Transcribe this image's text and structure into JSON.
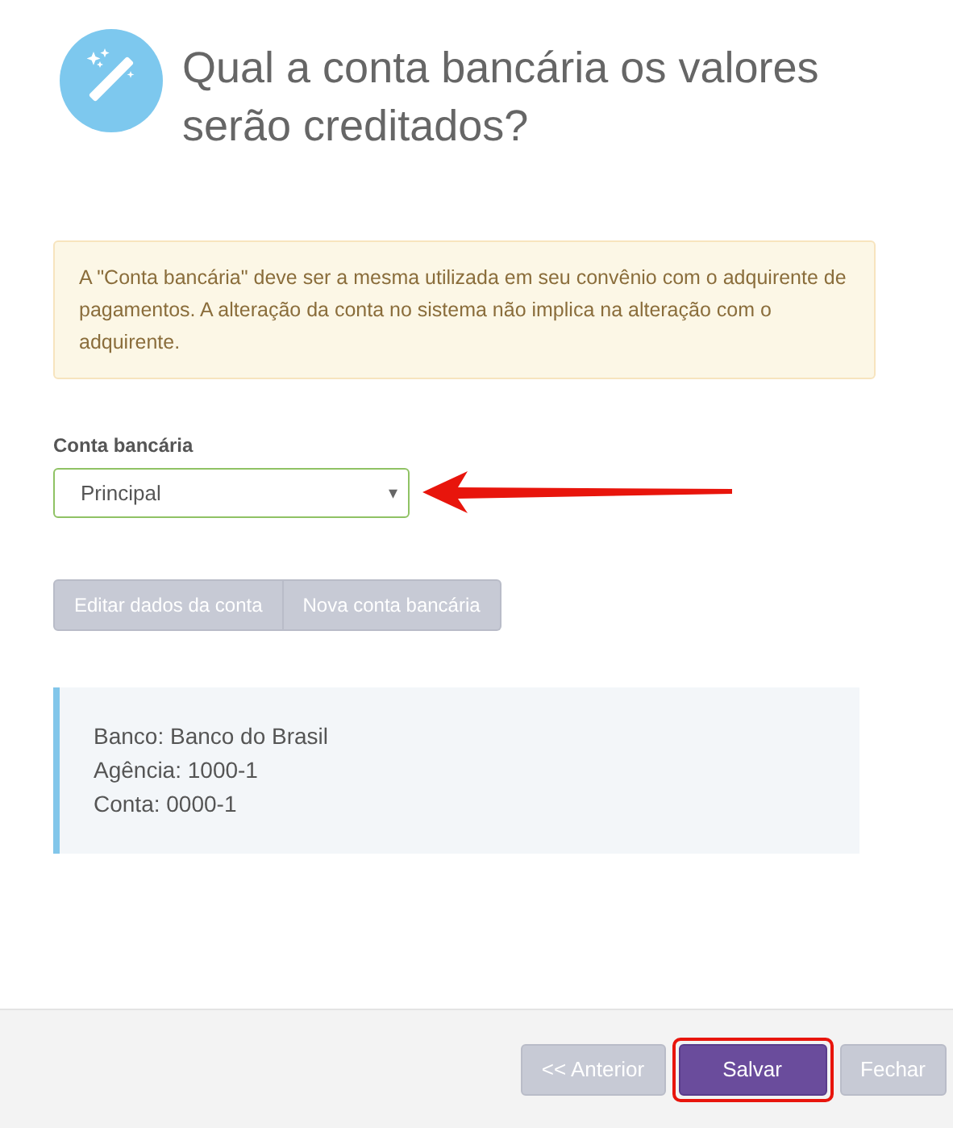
{
  "title": "Qual a conta bancária os valores serão creditados?",
  "alert": "A \"Conta bancária\" deve ser a mesma utilizada em seu convênio com o adquirente de pagamentos. A alteração da conta no sistema não implica na alteração com o adquirente.",
  "field": {
    "label": "Conta bancária",
    "value": "Principal",
    "caret": "▾"
  },
  "account_buttons": [
    {
      "label": "Editar dados da conta",
      "disabled": true
    },
    {
      "label": "Nova conta bancária",
      "disabled": true
    }
  ],
  "account_info": [
    "Banco: Banco do Brasil",
    "Agência: 1000-1",
    "Conta: 0000-1"
  ],
  "footer_buttons": [
    {
      "label": "<< Anterior",
      "disabled": true,
      "highlighted": false
    },
    {
      "label": "Salvar",
      "disabled": false,
      "highlighted": true
    },
    {
      "label": "Fechar",
      "disabled": true,
      "highlighted": false
    }
  ]
}
